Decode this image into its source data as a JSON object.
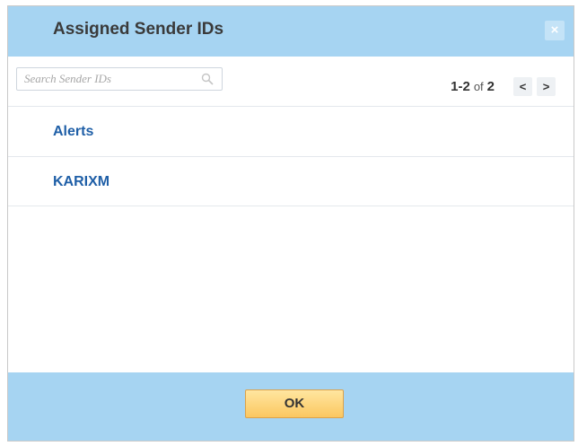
{
  "dialog": {
    "title": "Assigned Sender IDs",
    "close_icon": "close-icon",
    "close_glyph": "×"
  },
  "search": {
    "placeholder": "Search Sender IDs",
    "value": "",
    "icon": "search-icon"
  },
  "pager": {
    "range": "1-2",
    "of": "of",
    "total": "2",
    "prev_glyph": "<",
    "next_glyph": ">"
  },
  "items": [
    {
      "label": "Alerts"
    },
    {
      "label": "KARIXM"
    }
  ],
  "footer": {
    "ok_label": "OK"
  },
  "colors": {
    "header_bg": "#a6d4f2",
    "link": "#1f5fa7",
    "ok_button": "#fbc760"
  }
}
